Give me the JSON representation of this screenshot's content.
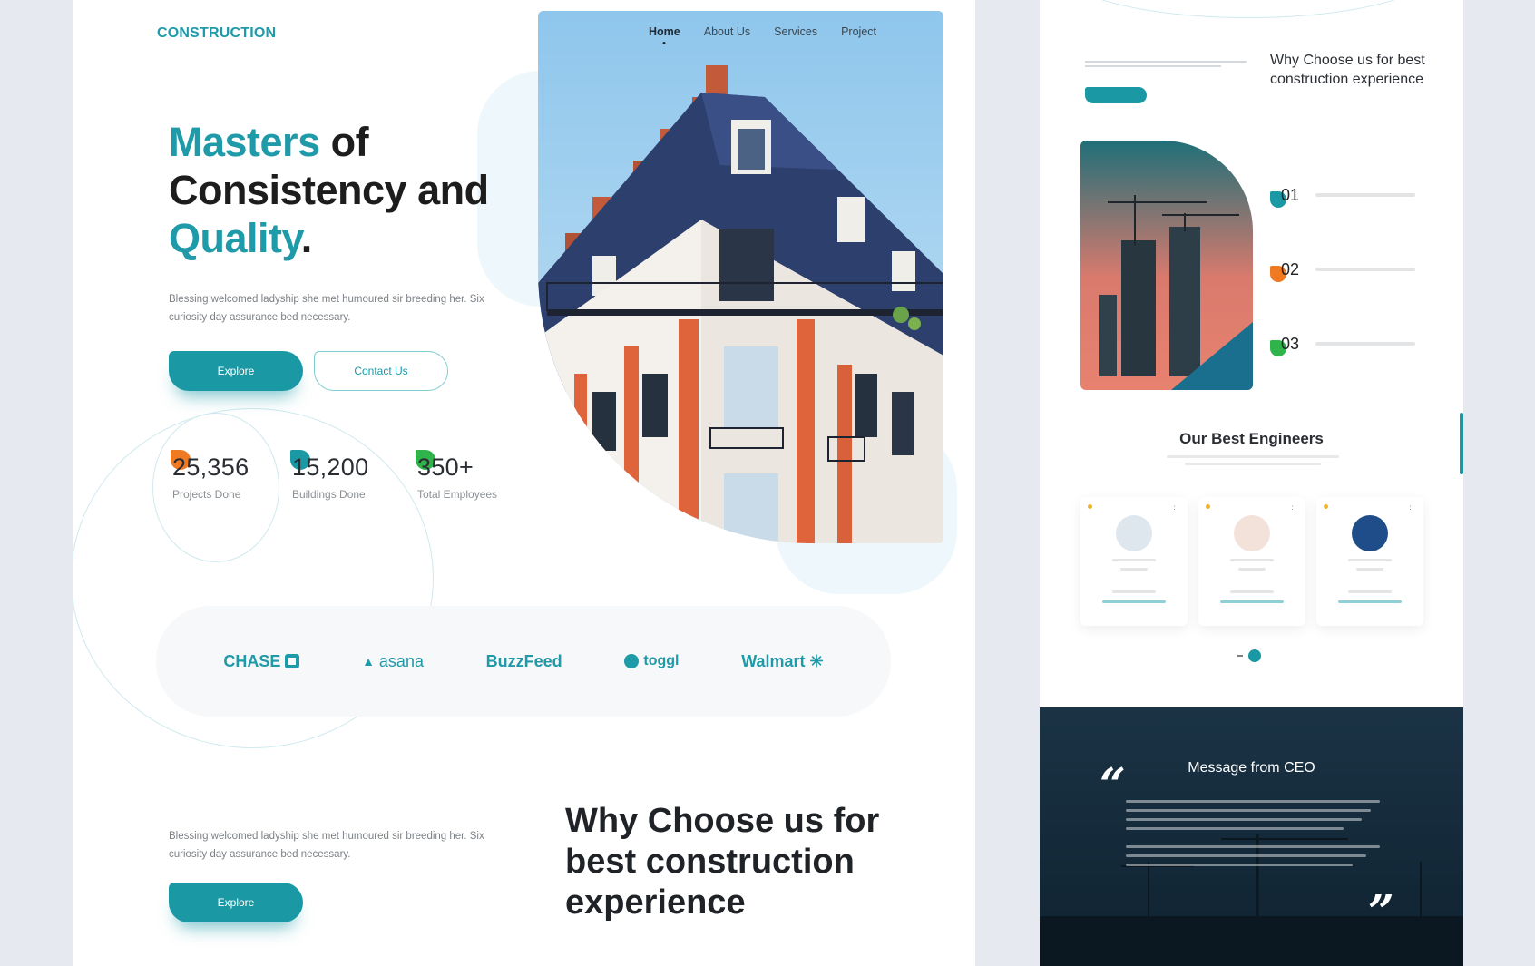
{
  "main": {
    "logo": "CONSTRUCTION",
    "nav": [
      "Home",
      "About Us",
      "Services",
      "Project"
    ],
    "headline": {
      "w1": "Masters",
      "w2": " of",
      "w3": "Consistency and",
      "w4": "Quality",
      "w5": "."
    },
    "hero_description": "Blessing welcomed ladyship she met humoured sir breeding her. Six curiosity day assurance bed necessary.",
    "explore_label": "Explore",
    "contact_label": "Contact Us",
    "stats": [
      {
        "value": "25,356",
        "label": "Projects Done",
        "color": "#f07a22"
      },
      {
        "value": "15,200",
        "label": "Buildings Done",
        "color": "#1a99a5"
      },
      {
        "value": "350+",
        "label": "Total Employees",
        "color": "#2fb34a"
      }
    ],
    "partners": [
      "CHASE",
      "asana",
      "BuzzFeed",
      "toggl",
      "Walmart"
    ],
    "why_description": "Blessing welcomed ladyship she met humoured sir breeding her. Six curiosity day assurance bed necessary.",
    "why_explore_label": "Explore",
    "why_title": "Why Choose us for best construction experience"
  },
  "side": {
    "why_title": "Why Choose us for best construction experience",
    "steps": [
      {
        "num": "01",
        "color": "#1a99a5"
      },
      {
        "num": "02",
        "color": "#f07a22"
      },
      {
        "num": "03",
        "color": "#2fb34a"
      }
    ],
    "engineers_title": "Our Best Engineers",
    "ceo_title": "Message from CEO"
  },
  "colors": {
    "accent": "#1a99a5",
    "orange": "#f07a22",
    "green": "#2fb34a",
    "dark": "#17303f"
  }
}
